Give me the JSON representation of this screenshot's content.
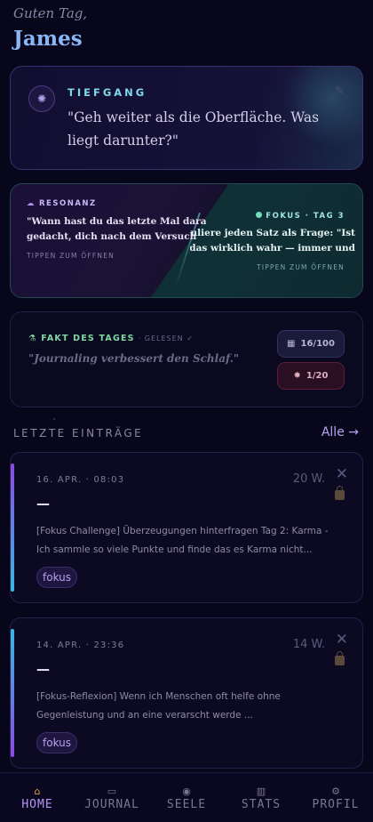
{
  "header": {
    "greeting": "Guten Tag,",
    "name": "James"
  },
  "tiefgang": {
    "label": "TIEFGANG",
    "quote": "\"Geh weiter als die Oberfläche. Was liegt darunter?\"",
    "icon": "orb-icon"
  },
  "resonanz": {
    "label": "RESONANZ",
    "text_line1": "\"Wann hast du das letzte Mal daran",
    "text_line2": "gedacht, dich nach dem Versuch",
    "tap": "TIPPEN ZUM ÖFFNEN"
  },
  "fokus": {
    "label": "FOKUS · TAG 3",
    "text_line1": "muliere jeden Satz als Frage: \"Ist",
    "text_line2": "das wirklich wahr — immer und",
    "tap": "TIPPEN ZUM ÖFFNEN"
  },
  "fakt": {
    "label": "FAKT DES TAGES",
    "status": "· GELESEN ✓",
    "text": "\"Journaling verbessert den Schlaf.\"",
    "count": "16/100",
    "points": "1/20"
  },
  "entries_section": {
    "title": "LETZTE EINTRÄGE",
    "all": "Alle →"
  },
  "entries": [
    {
      "date": "16. APR. · 08:03",
      "words": "20 W.",
      "title": "—",
      "body": "[Fokus Challenge] Überzeugungen hinterfragen Tag 2: Karma - Ich sammle so viele Punkte und finde das es Karma nicht...",
      "tag": "fokus",
      "bar_color": "#8a4ae0"
    },
    {
      "date": "14. APR. · 23:36",
      "words": "14 W.",
      "title": "—",
      "body": "[Fokus-Reflexion] Wenn ich Menschen oft helfe ohne Gegenleistung und an eine verarscht werde ...",
      "tag": "fokus",
      "bar_color": "#3ab8e0"
    }
  ],
  "nav": [
    {
      "label": "HOME",
      "icon": "house-icon",
      "active": true
    },
    {
      "label": "JOURNAL",
      "icon": "book-icon",
      "active": false
    },
    {
      "label": "SEELE",
      "icon": "soul-icon",
      "active": false
    },
    {
      "label": "STATS",
      "icon": "chart-icon",
      "active": false
    },
    {
      "label": "PROFIL",
      "icon": "gear-icon",
      "active": false
    }
  ]
}
